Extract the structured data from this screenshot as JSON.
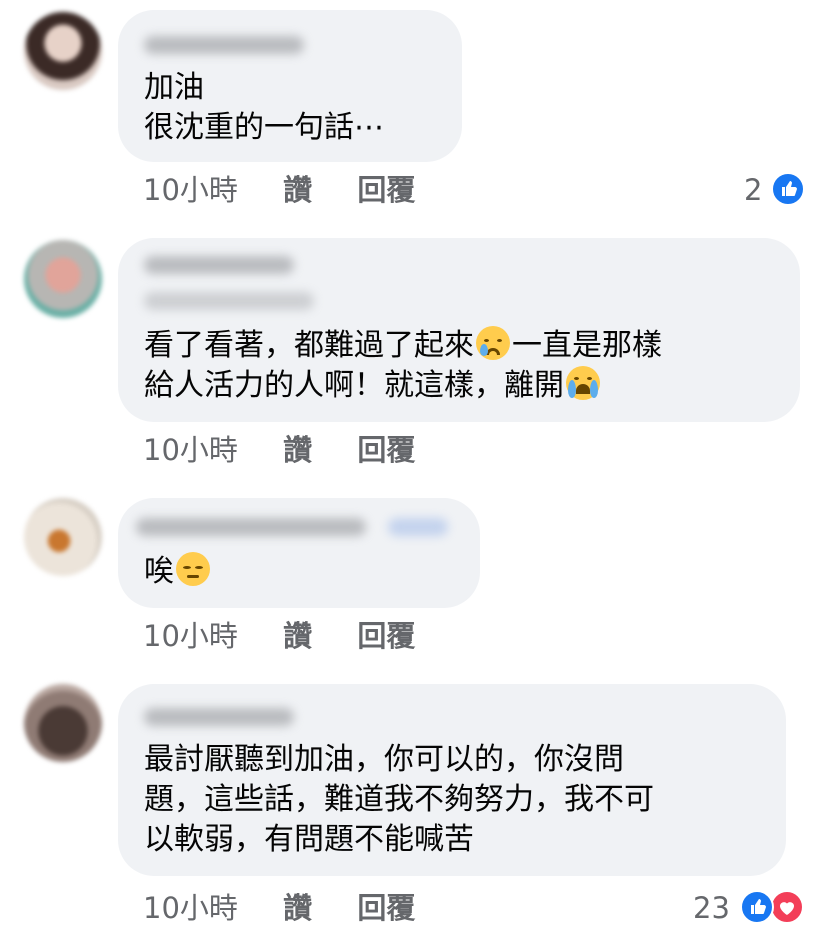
{
  "comments": [
    {
      "lines": [
        "加油",
        "很沈重的一句話⋯"
      ],
      "time": "10小時",
      "like": "讚",
      "reply": "回覆",
      "reaction_count": "2"
    },
    {
      "lines": [
        "看了看著，都難過了起來",
        "一直是那樣",
        "給人活力的人啊！就這樣，離開"
      ],
      "time": "10小時",
      "like": "讚",
      "reply": "回覆"
    },
    {
      "lines": [
        "唉"
      ],
      "time": "10小時",
      "like": "讚",
      "reply": "回覆"
    },
    {
      "lines": [
        "最討厭聽到加油，你可以的，你沒問",
        "題，這些話，難道我不夠努力，我不可",
        "以軟弱，有問題不能喊苦"
      ],
      "time": "10小時",
      "like": "讚",
      "reply": "回覆",
      "reaction_count": "23"
    }
  ],
  "colors": {
    "bubble": "#f0f2f5",
    "meta": "#65676b",
    "like_blue": "#1877f2",
    "love_red": "#f33e58"
  },
  "icons": {
    "like": "thumbs-up-icon",
    "love": "heart-icon",
    "crying": "crying-face-emoji",
    "sobbing": "sobbing-face-emoji",
    "pensive": "pensive-face-emoji"
  }
}
